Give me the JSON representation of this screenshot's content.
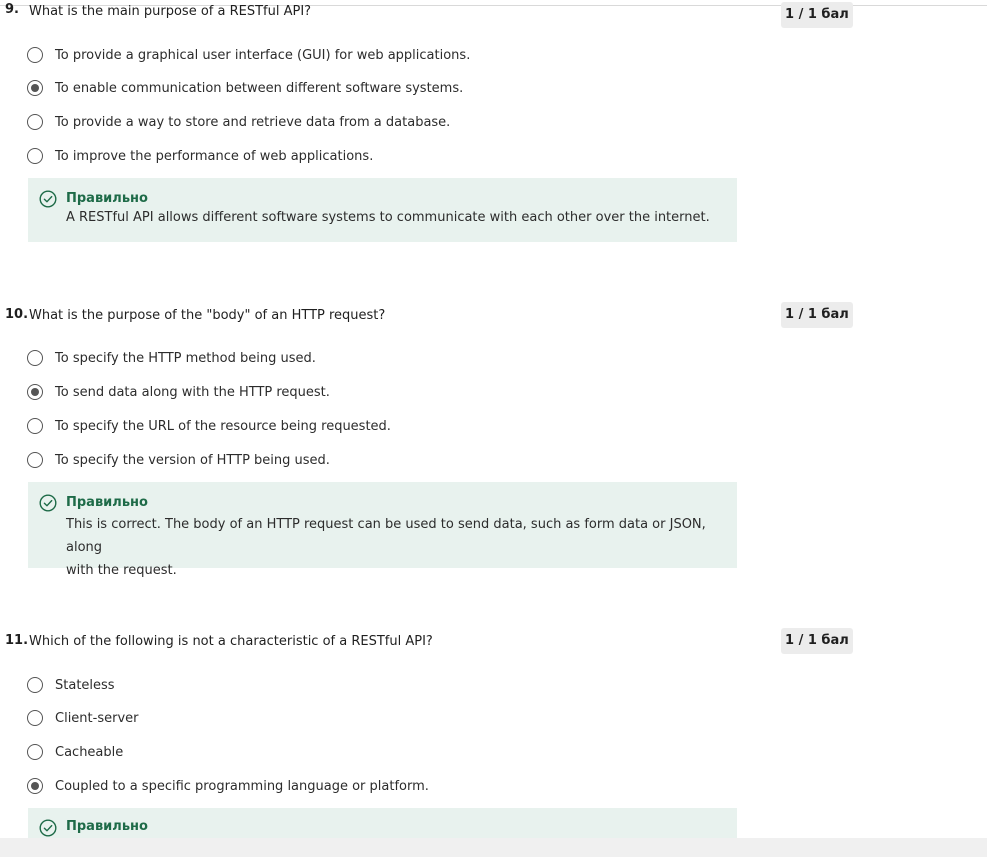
{
  "questions": [
    {
      "number": "9.",
      "text": "What is the main purpose of a RESTful API?",
      "score": "1 / 1 бал",
      "options": [
        {
          "label": "To provide a graphical user interface (GUI) for web applications.",
          "checked": false
        },
        {
          "label": "To enable communication between different software systems.",
          "checked": true
        },
        {
          "label": "To provide a way to store and retrieve data from a database.",
          "checked": false
        },
        {
          "label": "To improve the performance of web applications.",
          "checked": false
        }
      ],
      "feedback": {
        "status": "Правильно",
        "text": "A RESTful API allows different software systems to communicate with each other over the internet."
      }
    },
    {
      "number": "10.",
      "text": "What is the purpose of the \"body\" of an HTTP request?",
      "score": "1 / 1 бал",
      "options": [
        {
          "label": "To specify the HTTP method being used.",
          "checked": false
        },
        {
          "label": "To send data along with the HTTP request.",
          "checked": true
        },
        {
          "label": "To specify the URL of the resource being requested.",
          "checked": false
        },
        {
          "label": "To specify the version of HTTP being used.",
          "checked": false
        }
      ],
      "feedback": {
        "status": "Правильно",
        "text_line1": "This is correct. The body of an HTTP request can be used to send data, such as form data or JSON, along",
        "text_line2": "with the request."
      }
    },
    {
      "number": "11.",
      "text": "Which of the following is not a characteristic of a RESTful API?",
      "score": "1 / 1 бал",
      "options": [
        {
          "label": "Stateless",
          "checked": false
        },
        {
          "label": "Client-server",
          "checked": false
        },
        {
          "label": "Cacheable",
          "checked": false
        },
        {
          "label": "Coupled to a specific programming language or platform.",
          "checked": true
        }
      ],
      "feedback": {
        "status": "Правильно"
      }
    }
  ],
  "colors": {
    "feedback_bg": "#e8f2ee",
    "correct_green": "#1e6b48",
    "score_bg": "#ececec"
  }
}
